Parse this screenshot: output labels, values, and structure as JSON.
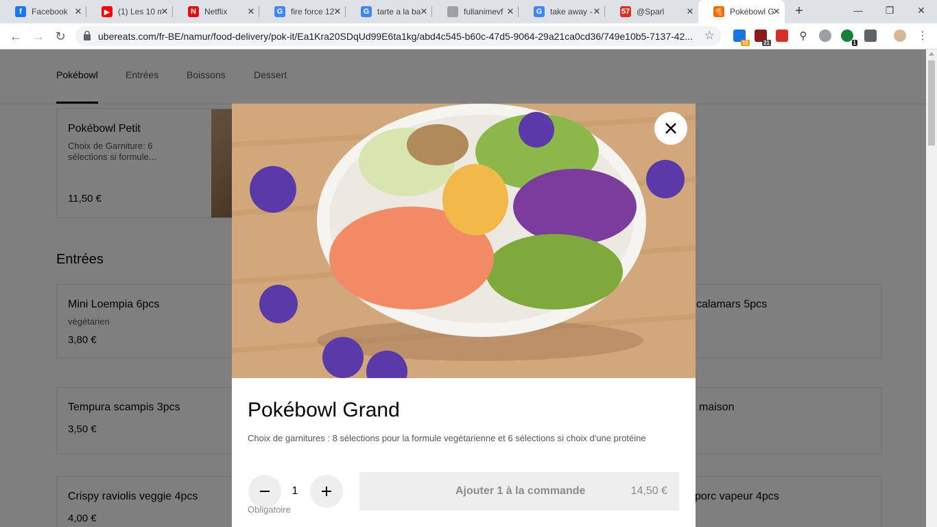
{
  "browser": {
    "tabs": [
      {
        "title": "Facebook",
        "icon": "facebook-icon",
        "color": "#1877f2",
        "glyph": "f"
      },
      {
        "title": "(1) Les 10 m",
        "icon": "youtube-icon",
        "color": "#ff0000",
        "glyph": "▶"
      },
      {
        "title": "Netflix",
        "icon": "netflix-icon",
        "color": "#e50914",
        "glyph": "N"
      },
      {
        "title": "fire force 12",
        "icon": "google-icon",
        "color": "#4285f4",
        "glyph": "G"
      },
      {
        "title": "tarte a la ba",
        "icon": "google-icon",
        "color": "#4285f4",
        "glyph": "G"
      },
      {
        "title": "fullanimevf",
        "icon": "globe-icon",
        "color": "#9aa0a6",
        "glyph": ""
      },
      {
        "title": "take away -",
        "icon": "google-icon",
        "color": "#4285f4",
        "glyph": "G"
      },
      {
        "title": "@Sparl",
        "icon": "calendar-icon",
        "color": "#d93025",
        "glyph": "57"
      },
      {
        "title": "Pokébowl G",
        "icon": "ubereats-icon",
        "color": "#ef6c00",
        "glyph": "🍕"
      }
    ],
    "url": "ubereats.com/fr-BE/namur/food-delivery/pok-it/Ea1Kra20SDqUd99E6ta1kg/abd4c545-b60c-47d5-9064-29a21ca0cd36/749e10b5-7137-42...",
    "extension_badges": [
      "10",
      "21",
      "1"
    ]
  },
  "categories": [
    "Pokébowl",
    "Entrées",
    "Boissons",
    "Dessert"
  ],
  "menu": {
    "top_item": {
      "name": "Pokébowl Petit",
      "desc": "Choix de Garniture: 6 sélections si formule...",
      "price": "11,50 €"
    },
    "section_title": "Entrées",
    "left_items": [
      {
        "name": "Mini Loempia 6pcs",
        "desc": "végétarien",
        "price": "3,80 €"
      },
      {
        "name": "Tempura scampis 3pcs",
        "desc": "",
        "price": "3,50 €"
      },
      {
        "name": "Crispy raviolis veggie 4pcs",
        "desc": "",
        "price": "4,00 €"
      }
    ],
    "right_items": [
      {
        "name": "calamars 5pcs"
      },
      {
        "name": "maison"
      },
      {
        "name": "porc vapeur 4pcs"
      }
    ]
  },
  "modal": {
    "title": "Pokébowl Grand",
    "description": "Choix de garnitures : 8 sélections pour la formule vegétarienne et 6 sélections si choix d'une protéine",
    "quantity": "1",
    "required_label": "Obligatoire",
    "add_label": "Ajouter 1 à la commande",
    "price": "14,50 €"
  }
}
